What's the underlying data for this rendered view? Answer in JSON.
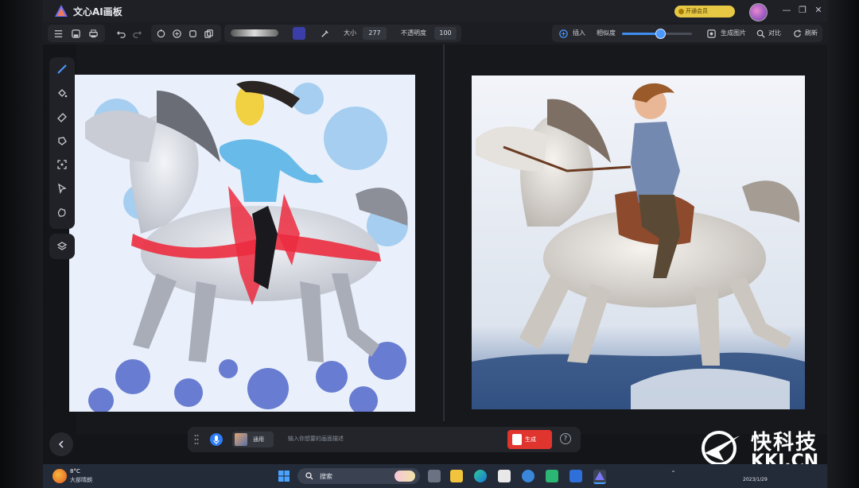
{
  "app": {
    "title": "文心AI画板"
  },
  "header": {
    "promo_label": "开通会员"
  },
  "toolbar": {
    "size_label": "大小",
    "size_value": "277",
    "opacity_label": "不透明度",
    "opacity_value": "100",
    "brush_color": "#3b3ea8",
    "insert_label": "插入",
    "similarity_label": "相似度",
    "similarity_level": 0.55,
    "generate_image_label": "生成图片",
    "compare_label": "对比",
    "refresh_label": "刷新"
  },
  "tools": [
    "brush-icon",
    "fill-icon",
    "eraser-icon",
    "lasso-icon",
    "select-icon",
    "pointer-icon",
    "hand-icon",
    "layers-icon"
  ],
  "prompt_bar": {
    "style_label": "通用",
    "input_placeholder": "输入你想要的画面描述",
    "generate_label": "生成"
  },
  "taskbar": {
    "weather_temp": "8°C",
    "weather_desc": "大部晴朗",
    "search_label": "搜索",
    "date": "2023/1/29"
  },
  "watermark": {
    "cn": "快科技",
    "en": "KKJ.CN"
  },
  "colors": {
    "accent": "#3f8df3",
    "generate": "#e0342f",
    "promo": "#e7c845"
  }
}
